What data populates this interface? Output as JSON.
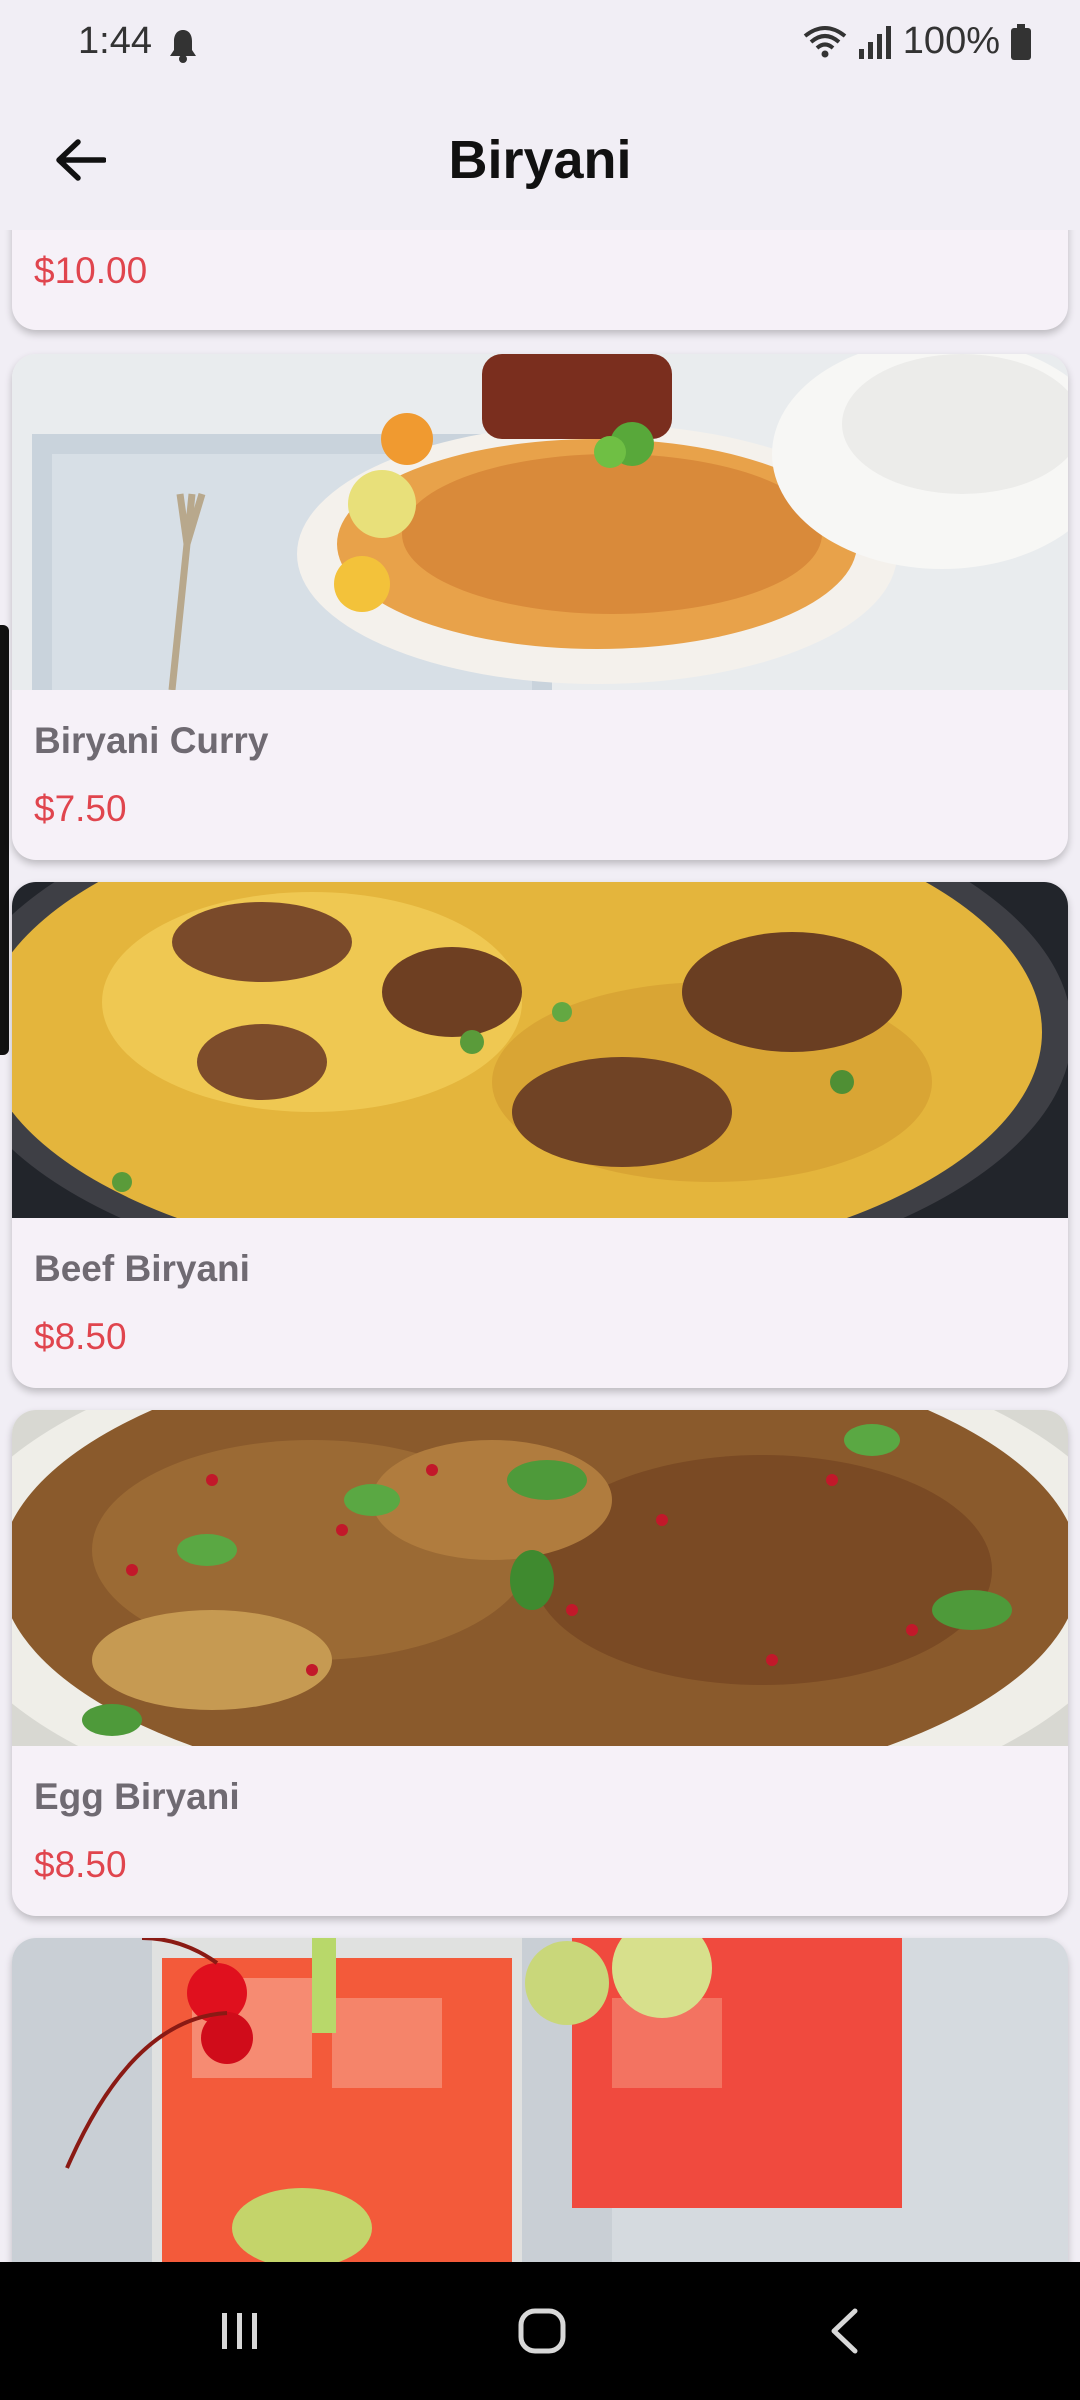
{
  "status": {
    "time": "1:44",
    "battery": "100%"
  },
  "appbar": {
    "title": "Biryani"
  },
  "items": [
    {
      "name": "",
      "price": "$10.00",
      "image": "food-photo"
    },
    {
      "name": "Biryani Curry",
      "price": "$7.50",
      "image": "biryani-curry-photo"
    },
    {
      "name": "Beef Biryani",
      "price": "$8.50",
      "image": "beef-biryani-photo"
    },
    {
      "name": "Egg Biryani",
      "price": "$8.50",
      "image": "egg-biryani-photo"
    },
    {
      "name": "",
      "price": "",
      "image": "red-drinks-photo"
    }
  ],
  "colors": {
    "price": "#e0454e",
    "background": "#f1eef5",
    "card": "#f6f1f8"
  }
}
